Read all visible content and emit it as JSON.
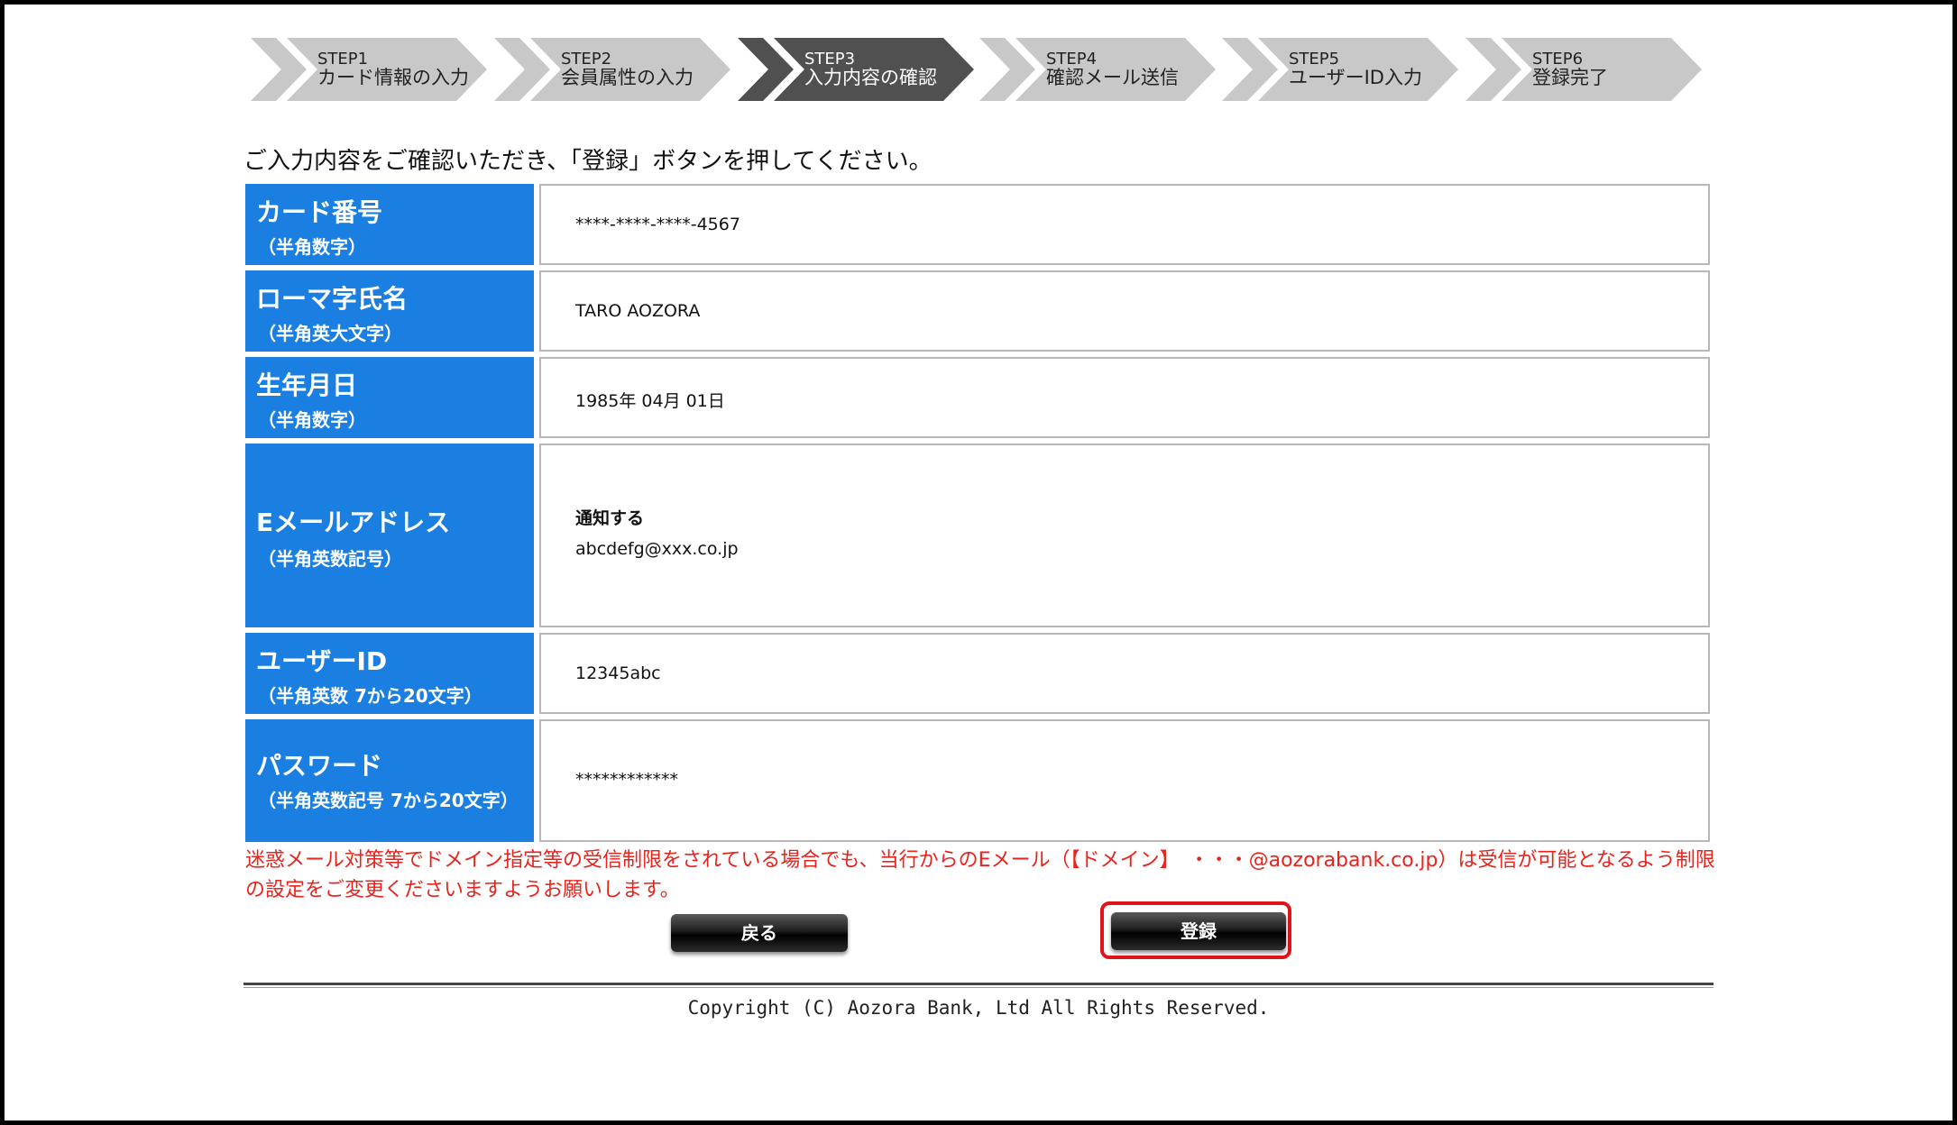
{
  "steps": [
    {
      "num": "STEP1",
      "name": "カード情報の入力",
      "active": false
    },
    {
      "num": "STEP2",
      "name": "会員属性の入力",
      "active": false
    },
    {
      "num": "STEP3",
      "name": "入力内容の確認",
      "active": true
    },
    {
      "num": "STEP4",
      "name": "確認メール送信",
      "active": false
    },
    {
      "num": "STEP5",
      "name": "ユーザーID入力",
      "active": false
    },
    {
      "num": "STEP6",
      "name": "登録完了",
      "active": false
    }
  ],
  "instruction": "ご入力内容をご確認いただき、「登録」ボタンを押してください。",
  "form": {
    "card": {
      "label": "カード番号",
      "sub": "（半角数字）",
      "value": "****-****-****-4567"
    },
    "name": {
      "label": "ローマ字氏名",
      "sub": "（半角英大文字）",
      "value": "TARO AOZORA"
    },
    "birth": {
      "label": "生年月日",
      "sub": "（半角数字）",
      "value": "1985年 04月 01日"
    },
    "email": {
      "label": "Eメールアドレス",
      "sub": "（半角英数記号）",
      "notify": "通知する",
      "value": "abcdefg@xxx.co.jp"
    },
    "userid": {
      "label": "ユーザーID",
      "sub": "（半角英数 7から20文字）",
      "value": "12345abc"
    },
    "password": {
      "label": "パスワード",
      "sub": "（半角英数記号 7から20文字）",
      "value": "************"
    }
  },
  "notice": "迷惑メール対策等でドメイン指定等の受信制限をされている場合でも、当行からのEメール（【ドメイン】　・・・@aozorabank.co.jp）は受信が可能となるよう制限の設定をご変更くださいますようお願いします。",
  "buttons": {
    "back": "戻る",
    "register": "登録"
  },
  "copyright": "Copyright (C) Aozora Bank, Ltd All Rights Reserved.",
  "colors": {
    "label_bg": "#1a7fe0",
    "notice": "#e8231c",
    "highlight": "#e0141d",
    "step_active": "#505050",
    "step_inactive": "#c8c8c8"
  }
}
